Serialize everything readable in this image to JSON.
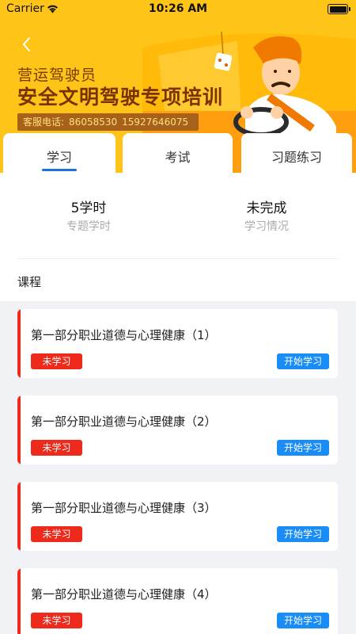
{
  "status_bar": {
    "carrier": "Carrier",
    "time": "10:26 AM"
  },
  "header": {
    "subtitle": "营运驾驶员",
    "title": "安全文明驾驶专项培训",
    "hotline_label": "客服电话:",
    "hotline_phone1": "86058530",
    "hotline_phone2": "15927646075"
  },
  "tabs": [
    {
      "label": "学习",
      "active": true
    },
    {
      "label": "考试",
      "active": false
    },
    {
      "label": "习题练习",
      "active": false
    }
  ],
  "summary": {
    "hours_value": "5学时",
    "hours_label": "专题学时",
    "status_value": "未完成",
    "status_label": "学习情况"
  },
  "section_title": "课程",
  "courses": [
    {
      "title": "第一部分职业道德与心理健康（1）",
      "status": "未学习",
      "action": "开始学习"
    },
    {
      "title": "第一部分职业道德与心理健康（2）",
      "status": "未学习",
      "action": "开始学习"
    },
    {
      "title": "第一部分职业道德与心理健康（3）",
      "status": "未学习",
      "action": "开始学习"
    },
    {
      "title": "第一部分职业道德与心理健康（4）",
      "status": "未学习",
      "action": "开始学习"
    }
  ],
  "colors": {
    "banner": "#ffc418",
    "accent_blue": "#1a8cf5",
    "status_red": "#ee2a1c"
  },
  "icons": {
    "back": "chevron-left-icon",
    "wifi": "wifi-icon",
    "battery": "battery-icon"
  }
}
